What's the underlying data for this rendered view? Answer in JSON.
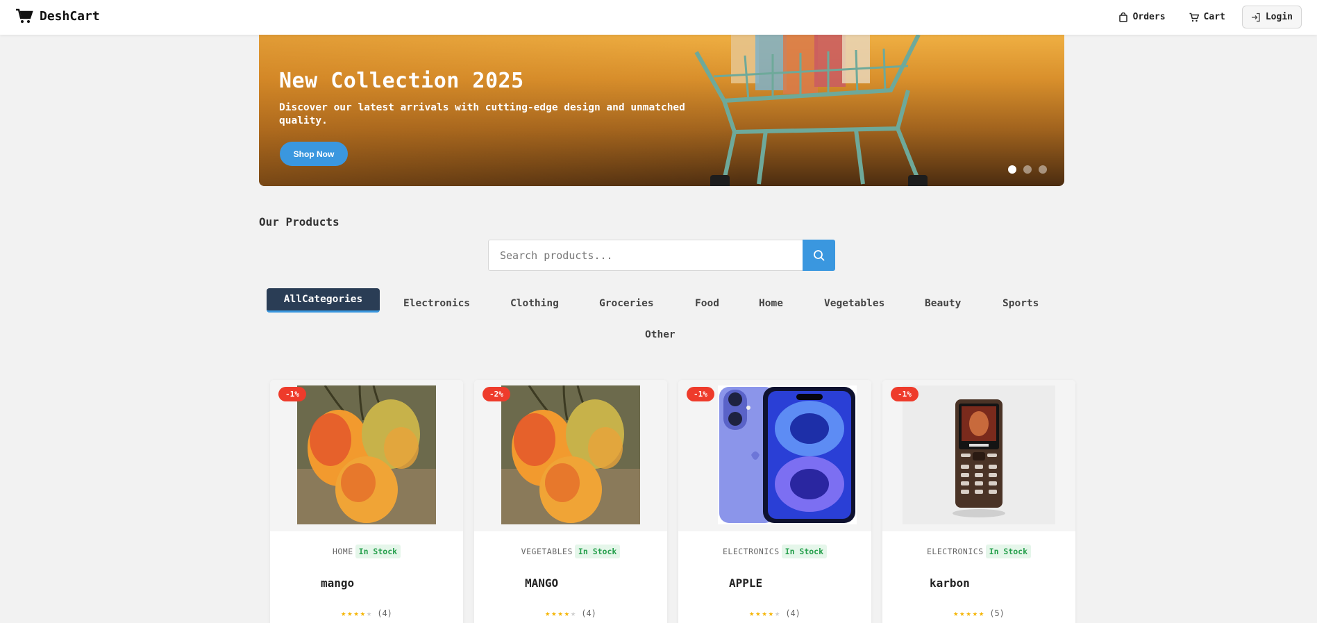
{
  "brand": {
    "name": "DeshCart",
    "icon": "cart-icon"
  },
  "nav": {
    "orders": {
      "label": "Orders",
      "icon": "bag-icon"
    },
    "cart": {
      "label": "Cart",
      "icon": "cart-icon"
    },
    "login": {
      "label": "Login",
      "icon": "login-icon"
    }
  },
  "hero": {
    "title": "New Collection 2025",
    "subtitle": "Discover our latest arrivals with cutting-edge design and unmatched quality.",
    "cta": "Shop Now",
    "slides": 3,
    "active_slide": 1
  },
  "section": {
    "title": "Our Products"
  },
  "search": {
    "placeholder": "Search products...",
    "value": "",
    "icon": "search-icon"
  },
  "categories": [
    "AllCategories",
    "Electronics",
    "Clothing",
    "Groceries",
    "Food",
    "Home",
    "Vegetables",
    "Beauty",
    "Sports",
    "Other"
  ],
  "active_category": "AllCategories",
  "products": [
    {
      "name": "mango",
      "category": "HOME",
      "stock": "In Stock",
      "discount": "-1%",
      "rating": 4,
      "rating_count": "(4)",
      "image": "mango"
    },
    {
      "name": "MANGO",
      "category": "VEGETABLES",
      "stock": "In Stock",
      "discount": "-2%",
      "rating": 4,
      "rating_count": "(4)",
      "image": "mango"
    },
    {
      "name": "APPLE",
      "category": "ELECTRONICS",
      "stock": "In Stock",
      "discount": "-1%",
      "rating": 4,
      "rating_count": "(4)",
      "image": "iphone"
    },
    {
      "name": "karbon",
      "category": "ELECTRONICS",
      "stock": "In Stock",
      "discount": "-1%",
      "rating": 5,
      "rating_count": "(5)",
      "image": "feature-phone"
    }
  ],
  "colors": {
    "accent": "#3a97df",
    "active_tab": "#2a3d55",
    "discount": "#ee3b2b",
    "in_stock": "#27a04d",
    "star": "#f5b400"
  }
}
